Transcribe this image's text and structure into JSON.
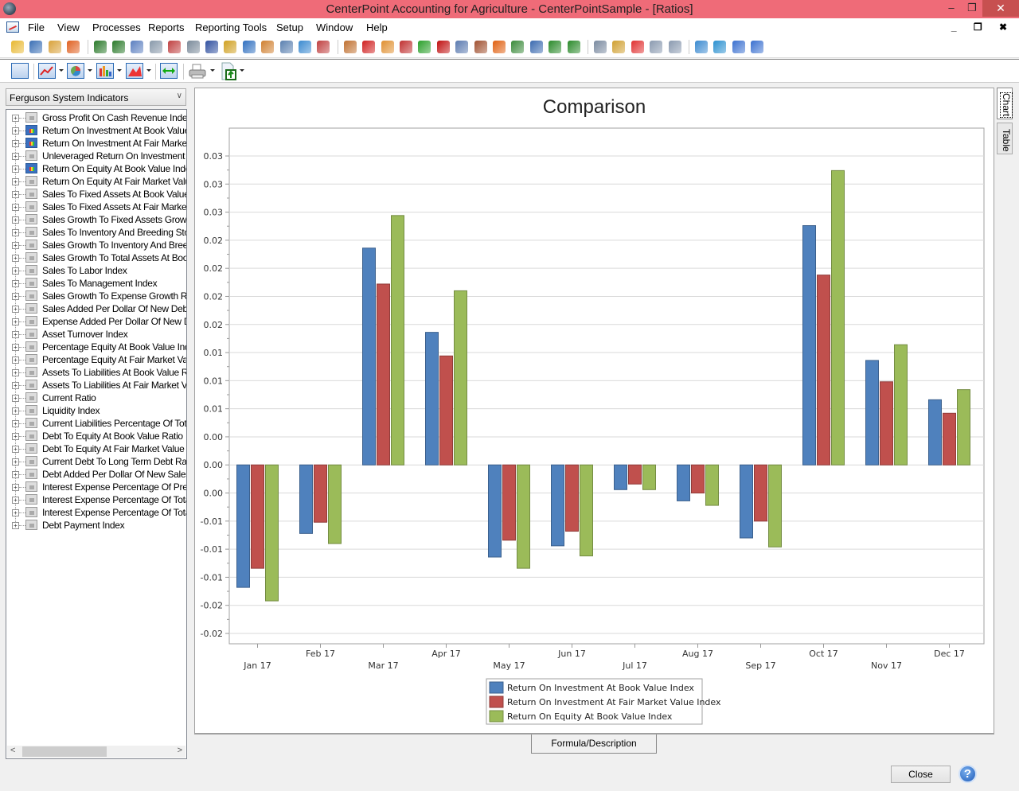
{
  "window": {
    "title": "CenterPoint Accounting for Agriculture - CenterPointSample - [Ratios]",
    "min_glyph": "–",
    "max_glyph": "❐",
    "close_glyph": "✕"
  },
  "menu": {
    "items": [
      "File",
      "View",
      "Processes",
      "Reports",
      "Reporting Tools",
      "Setup",
      "Window",
      "Help"
    ],
    "mdi_controls": "_ ❐ ✖"
  },
  "toolbar1": {
    "icons": [
      "open-company-icon",
      "exit-icon",
      "backup-icon",
      "wizard-icon",
      "undo-transaction-icon",
      "redo-transaction-icon",
      "journal-entry-icon",
      "document-preview-icon",
      "invoice-icon",
      "print-checks-icon",
      "ledger-icon",
      "balance-scale-icon",
      "edit-icon",
      "customers-icon",
      "reconcile-icon",
      "spreadsheet-icon",
      "refresh-icon",
      "employees-icon",
      "payroll-icon",
      "transfer-icon",
      "vehicles-icon",
      "dollar-icon",
      "book-icon",
      "calendar-icon",
      "inventory-icon",
      "alarm-clock-icon",
      "home-icon",
      "id-card-icon",
      "money-in-icon",
      "money-out-icon",
      "notes-icon",
      "binoculars-icon",
      "report-chart-icon",
      "document-p-icon",
      "document-s-icon",
      "web-globe-icon",
      "globe-icon",
      "help-icon",
      "info-icon"
    ]
  },
  "toolbar2": {
    "icons": [
      "list-view-icon",
      "line-chart-icon",
      "pie-chart-icon",
      "bar-chart-icon",
      "area-chart-icon",
      "fit-width-icon",
      "printer-icon",
      "export-icon"
    ]
  },
  "left_panel": {
    "category_select": "Ferguson System Indicators",
    "tree_items": [
      {
        "label": "Gross Profit On Cash Revenue Index",
        "active": false
      },
      {
        "label": "Return On Investment At Book Value I",
        "active": true
      },
      {
        "label": "Return On Investment At Fair Market V",
        "active": true
      },
      {
        "label": "Unleveraged Return On Investment In",
        "active": false
      },
      {
        "label": "Return On Equity At Book Value Index",
        "active": true
      },
      {
        "label": "Return On Equity At Fair Market Value",
        "active": false
      },
      {
        "label": "Sales To Fixed Assets At Book Value I",
        "active": false
      },
      {
        "label": "Sales To Fixed Assets At Fair Market V",
        "active": false
      },
      {
        "label": "Sales Growth To Fixed Assets Growth",
        "active": false
      },
      {
        "label": "Sales To Inventory And Breeding Stoc",
        "active": false
      },
      {
        "label": "Sales Growth To Inventory And Breedi",
        "active": false
      },
      {
        "label": "Sales Growth To Total Assets At Book",
        "active": false
      },
      {
        "label": "Sales To Labor Index",
        "active": false
      },
      {
        "label": "Sales To Management Index",
        "active": false
      },
      {
        "label": "Sales Growth To Expense Growth Rat",
        "active": false
      },
      {
        "label": "Sales Added Per Dollar Of New Debt F",
        "active": false
      },
      {
        "label": "Expense Added Per Dollar Of New De",
        "active": false
      },
      {
        "label": "Asset Turnover Index",
        "active": false
      },
      {
        "label": "Percentage Equity At Book Value Inde",
        "active": false
      },
      {
        "label": "Percentage Equity At Fair Market Valu",
        "active": false
      },
      {
        "label": "Assets To Liabilities At Book Value Ra",
        "active": false
      },
      {
        "label": "Assets To Liabilities At Fair Market Valu",
        "active": false
      },
      {
        "label": "Current Ratio",
        "active": false
      },
      {
        "label": "Liquidity Index",
        "active": false
      },
      {
        "label": "Current Liabilities Percentage Of Total",
        "active": false
      },
      {
        "label": "Debt To Equity At Book Value Ratio",
        "active": false
      },
      {
        "label": "Debt To Equity At Fair Market Value R",
        "active": false
      },
      {
        "label": "Current Debt To Long Term Debt Ratio",
        "active": false
      },
      {
        "label": "Debt Added Per Dollar Of New Sales F",
        "active": false
      },
      {
        "label": "Interest Expense Percentage Of Pre-ta",
        "active": false
      },
      {
        "label": "Interest Expense Percentage Of Total",
        "active": false
      },
      {
        "label": "Interest Expense Percentage Of Total",
        "active": false
      },
      {
        "label": "Debt Payment Index",
        "active": false
      }
    ],
    "scroll_left": "<",
    "scroll_right": ">"
  },
  "side_tabs": {
    "chart": "Chart",
    "table": "Table"
  },
  "bottom": {
    "formula_tab": "Formula/Description",
    "close": "Close",
    "help": "?"
  },
  "chart_data": {
    "type": "bar",
    "title": "Comparison",
    "xlabel": "",
    "ylabel": "",
    "categories": [
      "Jan 17",
      "Feb 17",
      "Mar 17",
      "Apr 17",
      "May 17",
      "Jun 17",
      "Jul 17",
      "Aug 17",
      "Sep 17",
      "Oct 17",
      "Nov 17",
      "Dec 17"
    ],
    "series": [
      {
        "name": "Return On Investment At Book Value Index",
        "color": "#4f81bd",
        "values": [
          -0.0109,
          -0.0061,
          0.0193,
          0.0118,
          -0.0082,
          -0.0072,
          -0.0022,
          -0.0032,
          -0.0065,
          0.0213,
          0.0093,
          0.0058
        ]
      },
      {
        "name": "Return On Investment At Fair Market Value Index",
        "color": "#c0504d",
        "values": [
          -0.0092,
          -0.0051,
          0.0161,
          0.0097,
          -0.0067,
          -0.0059,
          -0.0017,
          -0.0025,
          -0.005,
          0.0169,
          0.0074,
          0.0046
        ]
      },
      {
        "name": "Return On Equity At Book Value Index",
        "color": "#9bbb59",
        "values": [
          -0.0121,
          -0.007,
          0.0222,
          0.0155,
          -0.0092,
          -0.0081,
          -0.0022,
          -0.0036,
          -0.0073,
          0.0262,
          0.0107,
          0.0067
        ]
      }
    ],
    "ylim": [
      -0.015,
      0.0275
    ],
    "ytick_step": 0.0025,
    "ytick_labels": [
      "0.03",
      "0.03",
      "0.03",
      "0.02",
      "0.02",
      "0.02",
      "0.02",
      "0.01",
      "0.01",
      "0.01",
      "0.00",
      "0.00",
      "0.00",
      "-0.01",
      "-0.01",
      "-0.01",
      "-0.02",
      "-0.02"
    ],
    "grid": true,
    "legend": "bottom-center"
  }
}
